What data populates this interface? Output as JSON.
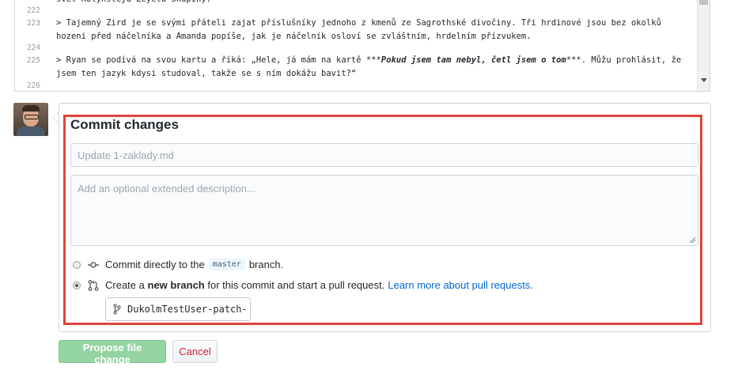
{
  "editor": {
    "lines": [
      {
        "num": "",
        "text": "svět Kolynstejú Zeyelú Skupiny."
      },
      {
        "num": "222",
        "text": ""
      },
      {
        "num": "223",
        "text": "> Tajemný Zird je se svými přáteli zajat příslušníky jednoho z kmenů ze Sagrothské divočiny. Tři hrdinové jsou bez okolků hozeni před náčelníka a Amanda popíše, jak je náčelník osloví se zvláštním, hrdelním přízvukem."
      },
      {
        "num": "224",
        "text": ""
      },
      {
        "num": "225",
        "text_pre": "> Ryan se podívá na svou kartu a říká: „Hele, já mám na kartě ***",
        "text_bold": "Pokud jsem tam nebyl, četl jsem o tom",
        "text_post": "***. Můžu prohlásit, že jsem ten jazyk kdysi studoval, takže se s ním dokážu bavit?“"
      },
      {
        "num": "226",
        "text": ""
      }
    ]
  },
  "commit": {
    "title": "Commit changes",
    "summary_placeholder": "Update 1-zaklady.md",
    "description_placeholder": "Add an optional extended description...",
    "option_direct_pre": "Commit directly to the",
    "option_direct_branch": "master",
    "option_direct_post": "branch.",
    "option_new_pre": "Create a",
    "option_new_bold": "new branch",
    "option_new_post": "for this commit and start a pull request.",
    "option_new_link": "Learn more about pull requests.",
    "branch_name": "DukolmTestUser-patch-",
    "selected_option": "new-branch"
  },
  "buttons": {
    "propose": "Propose file change",
    "cancel": "Cancel"
  },
  "colors": {
    "highlight": "#e0443a",
    "link": "#0366d6",
    "propose_bg": "#94d3a2",
    "cancel_text": "#cb2431"
  }
}
